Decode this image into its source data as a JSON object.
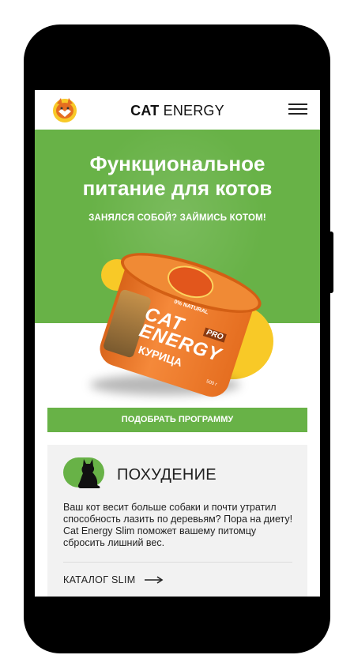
{
  "header": {
    "brand_bold": "CAT",
    "brand_light": "ENERGY"
  },
  "hero": {
    "title_line1": "Функциональное",
    "title_line2": "питание для котов",
    "subtitle": "ЗАНЯЛСЯ СОБОЙ? ЗАЙМИСЬ КОТОМ!"
  },
  "product": {
    "badge": "0% NATURAL",
    "word1": "CAT",
    "word2": "ENERGY",
    "pro": "PRO",
    "flavor": "КУРИЦА",
    "weight": "500 г"
  },
  "cta": {
    "label": "ПОДОБРАТЬ ПРОГРАММУ"
  },
  "card": {
    "title": "ПОХУДЕНИЕ",
    "description": "Ваш кот весит больше собаки и почти утратил способность лазить по деревьям? Пора на диету! Cat Energy Slim поможет вашему питомцу сбросить лишний вес.",
    "link_label": "КАТАЛОГ SLIM"
  },
  "colors": {
    "accent_green": "#68b247",
    "accent_yellow": "#f8c927",
    "jar_orange": "#f08a35"
  },
  "icons": {
    "logo": "cat-logo-icon",
    "menu": "hamburger-menu-icon",
    "card": "cat-silhouette-icon",
    "link": "arrow-right-icon"
  }
}
